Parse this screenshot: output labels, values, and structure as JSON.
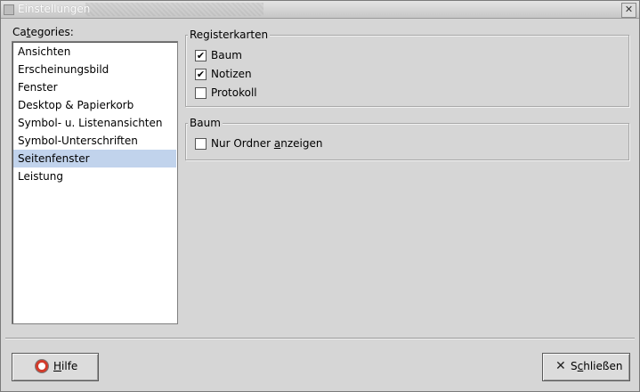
{
  "window": {
    "title": "Einstellungen",
    "close_glyph": "✕"
  },
  "categories": {
    "label_pre": "Ca",
    "label_mnemonic": "t",
    "label_post": "egories:",
    "items": [
      "Ansichten",
      "Erscheinungsbild",
      "Fenster",
      "Desktop & Papierkorb",
      "Symbol- u. Listenansichten",
      "Symbol-Unterschriften",
      "Seitenfenster",
      "Leistung"
    ],
    "selected_index": 6
  },
  "registerkarten": {
    "title": "Registerkarten",
    "options": [
      {
        "label": "Baum",
        "checked": true
      },
      {
        "label": "Notizen",
        "checked": true
      },
      {
        "label": "Protokoll",
        "checked": false
      }
    ]
  },
  "baum": {
    "title": "Baum",
    "option_pre": "Nur Ordner ",
    "option_mnemonic": "a",
    "option_post": "nzeigen",
    "checked": false
  },
  "buttons": {
    "help_mnemonic": "H",
    "help_rest": "ilfe",
    "close_pre": "S",
    "close_mnemonic": "c",
    "close_post": "hließen",
    "close_glyph": "✕"
  },
  "icons": {
    "help": "lifebuoy-icon",
    "close": "close-icon",
    "check": "✔"
  },
  "colors": {
    "selection": "#c1d3ec",
    "window_bg": "#d6d6d6",
    "list_bg": "#ffffff"
  }
}
